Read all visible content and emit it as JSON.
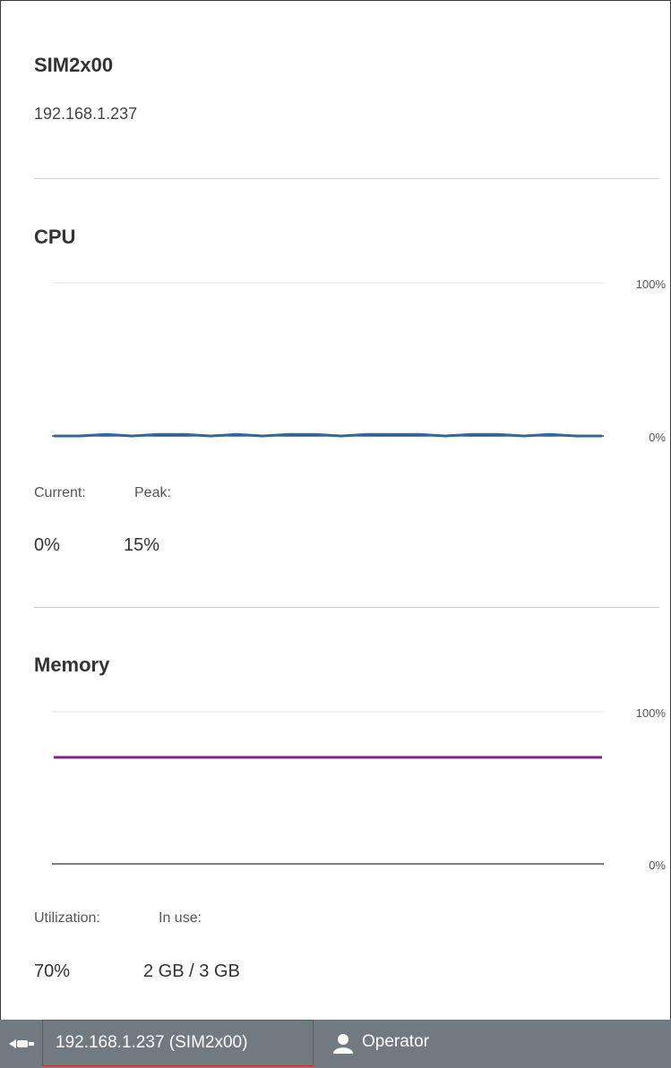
{
  "device": {
    "name": "SIM2x00",
    "ip": "192.168.1.237"
  },
  "cpu": {
    "title": "CPU",
    "axis_max_label": "100%",
    "axis_min_label": "0%",
    "current_label": "Current:",
    "peak_label": "Peak:",
    "current_value": "0%",
    "peak_value": "15%"
  },
  "memory": {
    "title": "Memory",
    "axis_max_label": "100%",
    "axis_min_label": "0%",
    "utilization_label": "Utilization:",
    "in_use_label": "In use:",
    "utilization_value": "70%",
    "in_use_value": "2 GB / 3 GB"
  },
  "statusbar": {
    "connection": "192.168.1.237 (SIM2x00)",
    "user": "Operator"
  },
  "colors": {
    "cpu_line": "#2e6a9e",
    "memory_line": "#8b1e8b",
    "statusbar": "#717a80",
    "highlight": "#e0242a"
  },
  "chart_data": [
    {
      "type": "line",
      "title": "CPU",
      "ylim": [
        0,
        100
      ],
      "y_ticks": [
        "0%",
        "100%"
      ],
      "series": [
        {
          "values": [
            0,
            0,
            1,
            0,
            1,
            1,
            0,
            1,
            0,
            1,
            1,
            0,
            1,
            1,
            1,
            0,
            1,
            1,
            0,
            1,
            0,
            0
          ]
        }
      ]
    },
    {
      "type": "line",
      "title": "Memory",
      "ylim": [
        0,
        100
      ],
      "y_ticks": [
        "0%",
        "100%"
      ],
      "series": [
        {
          "values": [
            70,
            70,
            70,
            70,
            70,
            70,
            70,
            70,
            70,
            70,
            70,
            70
          ]
        }
      ]
    }
  ]
}
